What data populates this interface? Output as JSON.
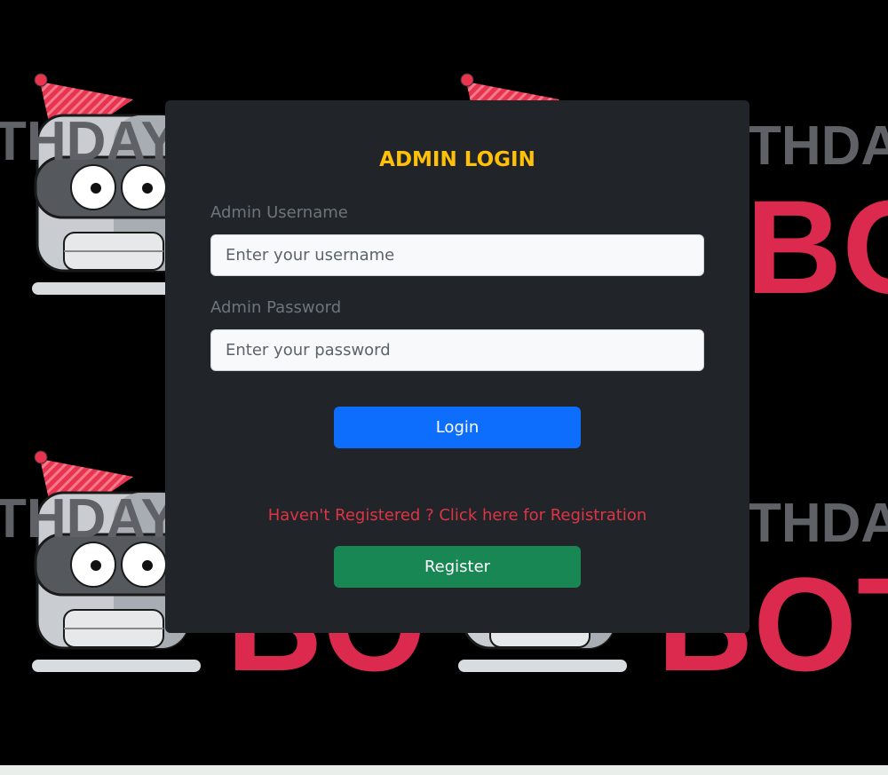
{
  "background": {
    "tile_word_top": "THDAY",
    "tile_word_bottom": "BOT",
    "colors": {
      "page": "#000000",
      "word_gray": "#5f6166",
      "word_red": "#dc2a4f",
      "hat": "#e8344f"
    }
  },
  "login_card": {
    "title": "ADMIN LOGIN",
    "username_label": "Admin Username",
    "username_placeholder": "Enter your username",
    "username_value": "",
    "password_label": "Admin Password",
    "password_placeholder": "Enter your password",
    "password_value": "",
    "login_button": "Login",
    "registration_link": "Haven't Registered ? Click here for Registration",
    "register_button": "Register"
  },
  "colors": {
    "card_bg": "#212529",
    "title": "#ffc107",
    "label": "#6c757d",
    "login_button": "#0d6efd",
    "register_button": "#198754",
    "link": "#dc3545"
  }
}
